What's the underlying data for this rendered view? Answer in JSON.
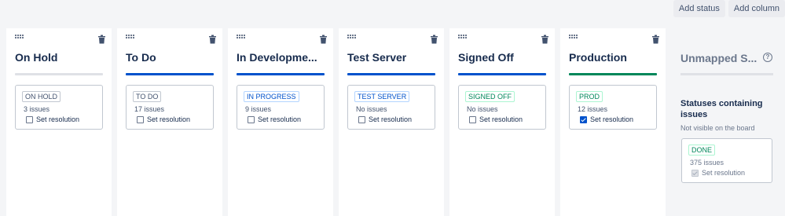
{
  "toolbar": {
    "add_status_label": "Add status",
    "add_column_label": "Add column"
  },
  "columns": [
    {
      "name": "On Hold",
      "bar_color": "#dfe1e6",
      "status": {
        "lozenge": "ON HOLD",
        "lozenge_color": "#42526e",
        "lozenge_border": "#c1c7d0",
        "count": "3 issues",
        "resolution_label": "Set resolution",
        "resolution_checked": false
      }
    },
    {
      "name": "To Do",
      "bar_color": "#0052cc",
      "status": {
        "lozenge": "TO DO",
        "lozenge_color": "#42526e",
        "lozenge_border": "#c1c7d0",
        "count": "17 issues",
        "resolution_label": "Set resolution",
        "resolution_checked": false
      }
    },
    {
      "name": "In Developme...",
      "bar_color": "#0052cc",
      "status": {
        "lozenge": "IN PROGRESS",
        "lozenge_color": "#0052cc",
        "lozenge_border": "#b3d4ff",
        "count": "9 issues",
        "resolution_label": "Set resolution",
        "resolution_checked": false
      }
    },
    {
      "name": "Test Server",
      "bar_color": "#0052cc",
      "status": {
        "lozenge": "TEST SERVER",
        "lozenge_color": "#0052cc",
        "lozenge_border": "#b3d4ff",
        "count": "No issues",
        "resolution_label": "Set resolution",
        "resolution_checked": false
      }
    },
    {
      "name": "Signed Off",
      "bar_color": "#0052cc",
      "status": {
        "lozenge": "SIGNED OFF",
        "lozenge_color": "#00875a",
        "lozenge_border": "#abf5d1",
        "count": "No issues",
        "resolution_label": "Set resolution",
        "resolution_checked": false
      }
    },
    {
      "name": "Production",
      "bar_color": "#00875a",
      "status": {
        "lozenge": "PROD",
        "lozenge_color": "#00875a",
        "lozenge_border": "#abf5d1",
        "count": "12 issues",
        "resolution_label": "Set resolution",
        "resolution_checked": true
      }
    }
  ],
  "unmapped": {
    "title": "Unmapped S...",
    "help_icon": "?",
    "heading": "Statuses containing issues",
    "subtext": "Not visible on the board",
    "status": {
      "lozenge": "DONE",
      "lozenge_color": "#00875a",
      "lozenge_border": "#abf5d1",
      "count": "375 issues",
      "resolution_label": "Set resolution",
      "resolution_checked": true
    }
  },
  "icons": {
    "drag": "drag-handle-icon",
    "delete": "trash-icon",
    "help": "question-circle-icon"
  }
}
